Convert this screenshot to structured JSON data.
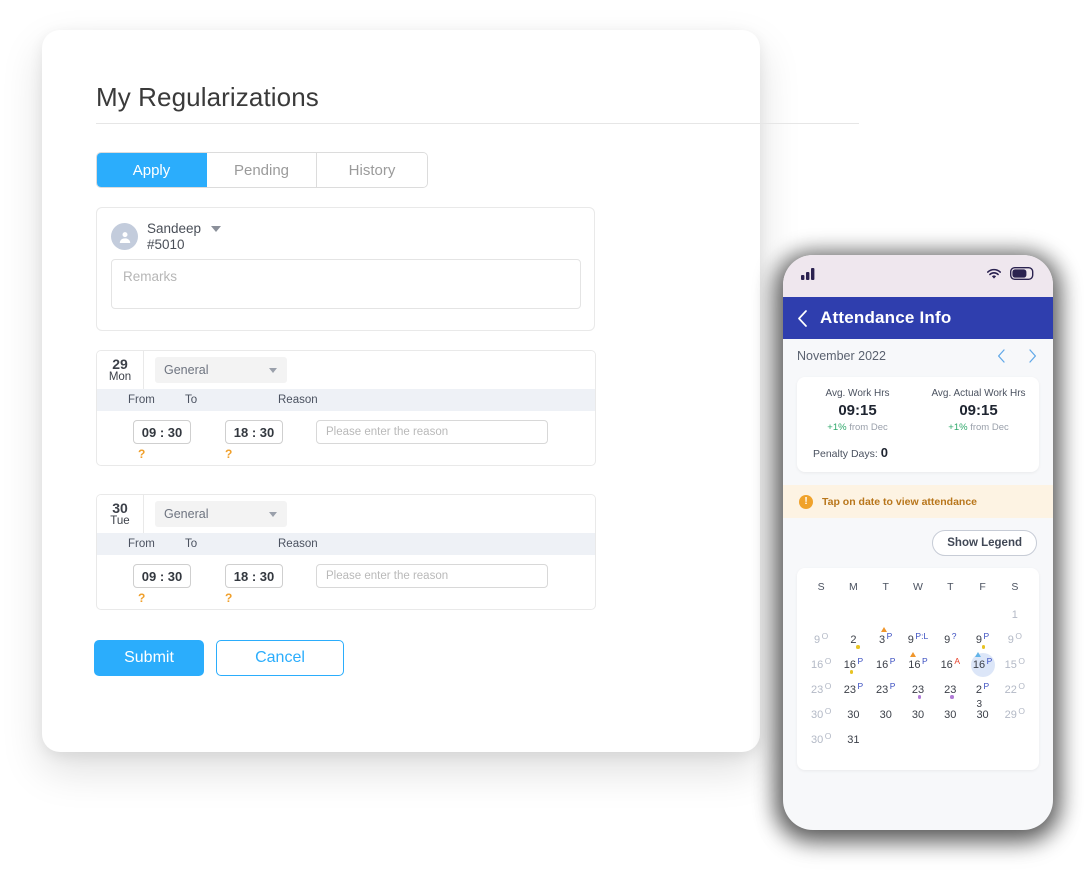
{
  "desktop": {
    "page_title": "My Regularizations",
    "tabs": [
      {
        "label": "Apply",
        "active": true
      },
      {
        "label": "Pending",
        "active": false
      },
      {
        "label": "History",
        "active": false
      }
    ],
    "employee": {
      "name": "Sandeep",
      "id": "#5010",
      "avatar_icon": "user-avatar-icon",
      "caret_icon": "chevron-down-icon"
    },
    "remarks": {
      "value": "",
      "placeholder": "Remarks"
    },
    "columns": {
      "from": "From",
      "to": "To",
      "reason": "Reason"
    },
    "day_rows": [
      {
        "day_number": "29",
        "day_of_week": "Mon",
        "shift": "General",
        "from_time": "09 : 30",
        "to_time": "18 : 30",
        "from_flag": "?",
        "to_flag": "?",
        "reason_value": "",
        "reason_placeholder": "Please enter the reason"
      },
      {
        "day_number": "30",
        "day_of_week": "Tue",
        "shift": "General",
        "from_time": "09 : 30",
        "to_time": "18 : 30",
        "from_flag": "?",
        "to_flag": "?",
        "reason_value": "",
        "reason_placeholder": "Please enter the reason"
      }
    ],
    "actions": {
      "submit": "Submit",
      "cancel": "Cancel"
    },
    "colors": {
      "accent": "#2badfc",
      "flag": "#f0a02c"
    }
  },
  "phone": {
    "status_bar": {
      "signal_icon": "cellular-signal-icon",
      "wifi_icon": "wifi-icon",
      "battery_icon": "battery-icon"
    },
    "header": {
      "title": "Attendance Info",
      "back_icon": "chevron-left-icon"
    },
    "month": {
      "label": "November 2022",
      "prev_icon": "chevron-left-icon",
      "next_icon": "chevron-right-icon"
    },
    "stats": {
      "cards": [
        {
          "label": "Avg. Work Hrs",
          "value": "09:15",
          "delta": "+1%",
          "delta_rest": "from Dec"
        },
        {
          "label": "Avg. Actual Work Hrs",
          "value": "09:15",
          "delta": "+1%",
          "delta_rest": "from Dec"
        }
      ],
      "penalty_label": "Penalty Days:",
      "penalty_value": "0"
    },
    "alert": {
      "icon": "info-exclamation-icon",
      "text": "Tap on date to view attendance"
    },
    "legend_button": "Show Legend",
    "calendar": {
      "dow": [
        "S",
        "M",
        "T",
        "W",
        "T",
        "F",
        "S"
      ],
      "weeks": [
        [
          {
            "empty": true
          },
          {
            "empty": true
          },
          {
            "empty": true
          },
          {
            "empty": true
          },
          {
            "empty": true
          },
          {
            "empty": true
          },
          {
            "num": "1",
            "muted": true
          }
        ],
        [
          {
            "num": "9",
            "muted": true,
            "sup": "O",
            "sup_color": "grey"
          },
          {
            "num": "2",
            "dot": "yellow"
          },
          {
            "num": "3",
            "sup": "P",
            "sup_color": "blue",
            "tri": "orange"
          },
          {
            "num": "9",
            "sup": "P:L",
            "sup_color": "blue"
          },
          {
            "num": "9",
            "sup": "?",
            "sup_color": "blue"
          },
          {
            "num": "9",
            "sup": "P",
            "sup_color": "blue",
            "dot": "yellow"
          },
          {
            "num": "9",
            "muted": true,
            "sup": "O",
            "sup_color": "grey"
          }
        ],
        [
          {
            "num": "16",
            "muted": true,
            "sup": "O",
            "sup_color": "grey"
          },
          {
            "num": "16",
            "sup": "P",
            "sup_color": "blue",
            "dot": "yellow"
          },
          {
            "num": "16",
            "sup": "P",
            "sup_color": "blue"
          },
          {
            "num": "16",
            "sup": "P",
            "sup_color": "blue",
            "tri": "orange"
          },
          {
            "num": "16",
            "sup": "A",
            "sup_color": "red"
          },
          {
            "num": "16",
            "sup": "P",
            "sup_color": "blue",
            "tri": "blue",
            "selected": true
          },
          {
            "num": "15",
            "muted": true,
            "sup": "O",
            "sup_color": "grey"
          }
        ],
        [
          {
            "num": "23",
            "muted": true,
            "sup": "O",
            "sup_color": "grey"
          },
          {
            "num": "23",
            "sup": "P",
            "sup_color": "blue"
          },
          {
            "num": "23",
            "sup": "P",
            "sup_color": "blue"
          },
          {
            "num": "23",
            "dot": "purple"
          },
          {
            "num": "23",
            "dot": "purple"
          },
          {
            "num": "2",
            "sup": "P",
            "sup_color": "blue"
          },
          {
            "num": "22",
            "muted": true,
            "sup": "O",
            "sup_color": "grey"
          }
        ],
        [
          {
            "num": "30",
            "muted": true,
            "sup": "O",
            "sup_color": "grey"
          },
          {
            "num": "30"
          },
          {
            "num": "30"
          },
          {
            "num": "30"
          },
          {
            "num": "30"
          },
          {
            "num": "30",
            "sub": "3"
          },
          {
            "num": "29",
            "muted": true,
            "sup": "O",
            "sup_color": "grey"
          }
        ],
        [
          {
            "num": "30",
            "muted": true,
            "sup": "O",
            "sup_color": "grey"
          },
          {
            "num": "31"
          },
          {
            "empty": true
          },
          {
            "empty": true
          },
          {
            "empty": true
          },
          {
            "empty": true
          },
          {
            "empty": true
          }
        ]
      ]
    },
    "colors": {
      "header": "#2f3eae",
      "status_bg": "#efe7ee",
      "alert_bg": "#fdf3e3"
    }
  }
}
